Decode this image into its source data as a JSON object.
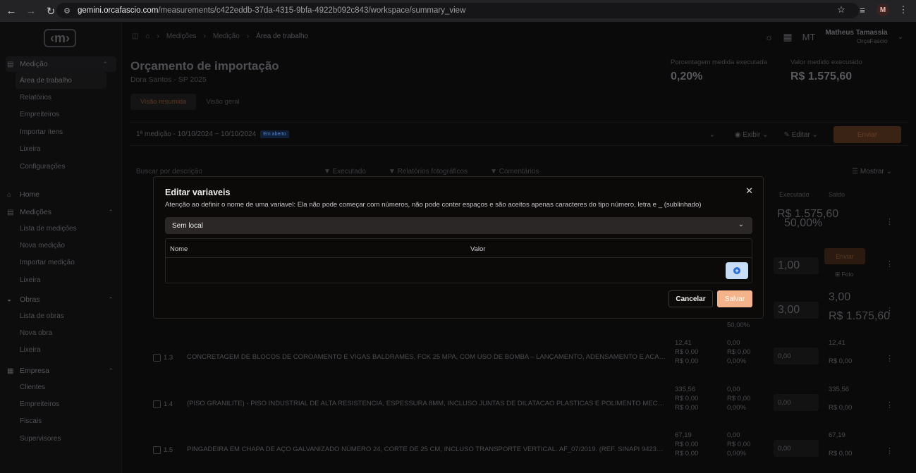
{
  "browser": {
    "url_domain": "gemini.orcafascio.com",
    "url_path": "/measurements/c422eddb-37da-4315-9bfa-4922b092c843/workspace/summary_view",
    "profile_initial": "M"
  },
  "sidebar": {
    "medicao_head": "Medição",
    "medicao_items": [
      "Área de trabalho",
      "Relatórios",
      "Empreiteiros",
      "Importar itens",
      "Lixeira",
      "Configurações"
    ],
    "home": "Home",
    "medicoes_head": "Medições",
    "medicoes_items": [
      "Lista de medições",
      "Nova medição",
      "Importar medição",
      "Lixeira"
    ],
    "obras_head": "Obras",
    "obras_items": [
      "Lista de obras",
      "Nova obra",
      "Lixeira"
    ],
    "empresa_head": "Empresa",
    "empresa_items": [
      "Clientes",
      "Empreiteiros",
      "Fiscais",
      "Supervisores"
    ]
  },
  "topbar": {
    "crumbs": [
      "Medições",
      "Medição",
      "Área de trabalho"
    ],
    "avatar_initials": "MT",
    "user_name": "Matheus Tamassia",
    "user_org": "OrçaFascio"
  },
  "header": {
    "title": "Orçamento de importação",
    "subtitle": "Dora Santos - SP 2025",
    "kpi1_label": "Porcentagem medida executada",
    "kpi1_value": "0,20%",
    "kpi2_label": "Valor medido executado",
    "kpi2_value": "R$ 1.575,60"
  },
  "tabs": [
    "Visão resumida",
    "Visão geral"
  ],
  "filterbar": {
    "measurement": "1ª medição - 10/10/2024 ~ 10/10/2024",
    "badge": "Em aberto",
    "exibir": "Exibir",
    "editar": "Editar",
    "enviar": "Enviar"
  },
  "toolbar": {
    "search": "Buscar por descrição",
    "filters": [
      "Executado",
      "Relatórios fotográficos",
      "Comentários"
    ],
    "mostrar": "Mostrar"
  },
  "table": {
    "col_executado": "Executado",
    "col_saldo": "Saldo",
    "rows": [
      {
        "num": "1.3",
        "desc": "CONCRETAGEM DE BLOCOS DE COROAMENTO E VIGAS BALDRAMES, FCK 25 MPA, COM USO DE BOMBA – LANÇAMENTO, ADENSAMENTO E ACABAMENTO.",
        "a": [
          "12,41",
          "R$ 0,00",
          "R$ 0,00"
        ],
        "b": [
          "0,00",
          "R$ 0,00",
          "0,00%"
        ],
        "exec": "0,00",
        "saldo": [
          "12,41",
          "R$ 0,00"
        ]
      },
      {
        "num": "1.4",
        "desc": "(PISO GRANILITE) - PISO INDUSTRIAL DE ALTA RESISTENCIA, ESPESSURA 8MM, INCLUSO JUNTAS DE DILATACAO PLASTICAS E POLIMENTO MECANIZADO",
        "a": [
          "335,56",
          "R$ 0,00",
          "R$ 0,00"
        ],
        "b": [
          "0,00",
          "R$ 0,00",
          "0,00%"
        ],
        "exec": "0,00",
        "saldo": [
          "335,56",
          "R$ 0,00"
        ]
      },
      {
        "num": "1.5",
        "desc": "PINGADEIRA EM CHAPA DE AÇO GALVANIZADO NÚMERO 24, CORTE DE 25 CM, INCLUSO TRANSPORTE VERTICAL. AF_07/2019. (REF. SINAPI 94231,4/2...",
        "a": [
          "67,19",
          "R$ 0,00",
          "R$ 0,00"
        ],
        "b": [
          "0,00",
          "R$ 0,00",
          "0,00%"
        ],
        "exec": "0,00",
        "saldo": [
          "67,19",
          "R$ 0,00"
        ]
      }
    ],
    "top_exec_value": "R$ 1.575,60",
    "top_exec_pct": "50,00%",
    "row2_exec": "1,00",
    "row2_enviar": "Enviar",
    "row2_foto": "Foto",
    "row3_exec": "3,00",
    "row3_saldo": [
      "3,00",
      "R$ 1.575,60"
    ],
    "row3_pct": "50,00%"
  },
  "modal": {
    "title": "Editar variaveis",
    "warning": "Atenção ao definir o nome de uma variavel: Ela não pode começar com números, não pode conter espaços e são aceitos apenas caracteres do tipo número, letra e _ (sublinhado)",
    "location": "Sem local",
    "col_name": "Nome",
    "col_value": "Valor",
    "cancel": "Cancelar",
    "save": "Salvar"
  }
}
